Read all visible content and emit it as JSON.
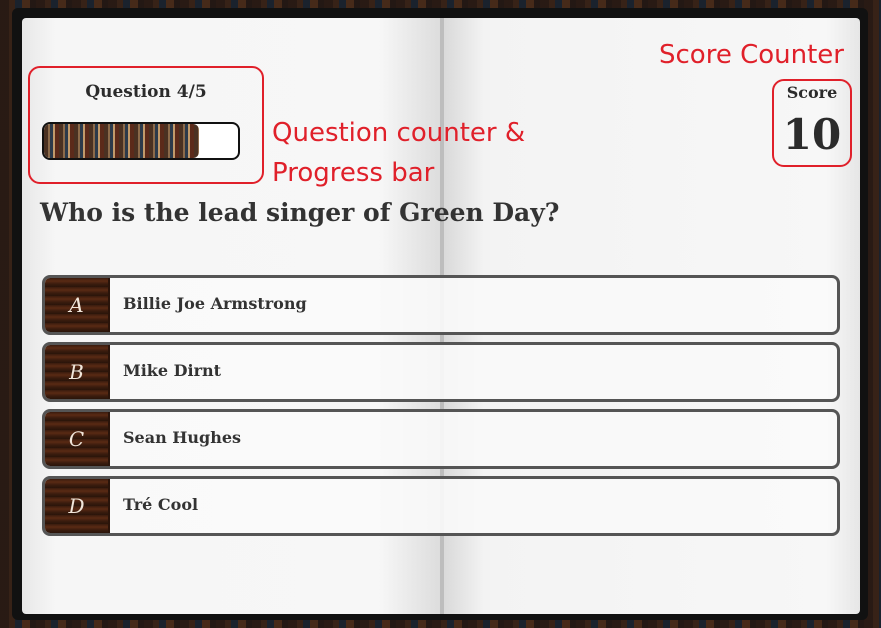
{
  "quiz": {
    "question_counter": "Question 4/5",
    "progress": 0.8,
    "question": "Who is the lead singer of Green Day?",
    "score_label": "Score",
    "score_value": "10",
    "options": [
      {
        "key": "A",
        "text": "Billie Joe Armstrong"
      },
      {
        "key": "B",
        "text": "Mike Dirnt"
      },
      {
        "key": "C",
        "text": "Sean Hughes"
      },
      {
        "key": "D",
        "text": "Tré Cool"
      }
    ]
  },
  "annotations": {
    "question_counter_line1": "Question counter &",
    "question_counter_line2": "Progress bar",
    "score_counter": "Score Counter"
  },
  "colors": {
    "annotation": "#e0202a",
    "page": "#f4f4f4",
    "option_key_bg": "#3a1c0e"
  }
}
